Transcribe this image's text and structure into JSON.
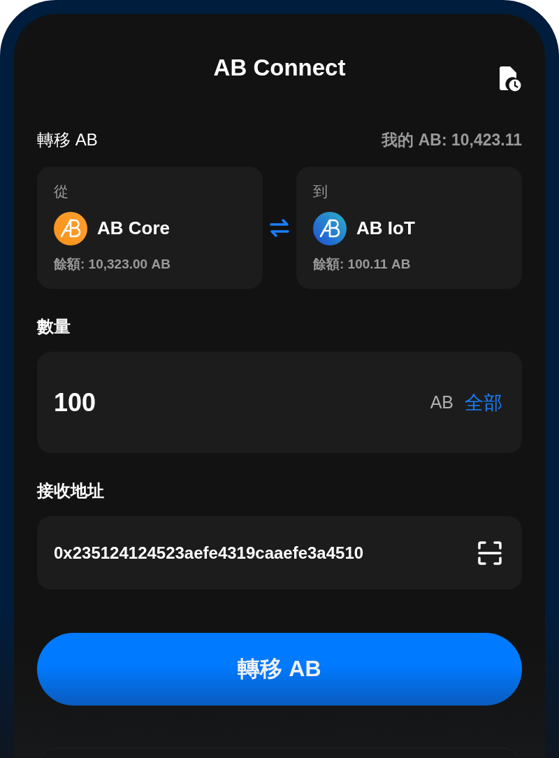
{
  "header": {
    "title": "AB Connect"
  },
  "transfer": {
    "title": "轉移 AB",
    "balance": "我的 AB: 10,423.11"
  },
  "accounts": [
    {
      "label": "從",
      "name": "AB Core",
      "balance": "餘額: 10,323.00 AB",
      "kind": "core"
    },
    {
      "label": "到",
      "name": "AB IoT",
      "balance": "餘額: 100.11 AB",
      "kind": "iot"
    }
  ],
  "amount": {
    "label": "數量",
    "value": "100",
    "unit": "AB",
    "max_button": "全部"
  },
  "recipient": {
    "label": "接收地址",
    "value": "0x235124124523aefe4319caaefe3a4510"
  },
  "submit": "轉移 AB"
}
